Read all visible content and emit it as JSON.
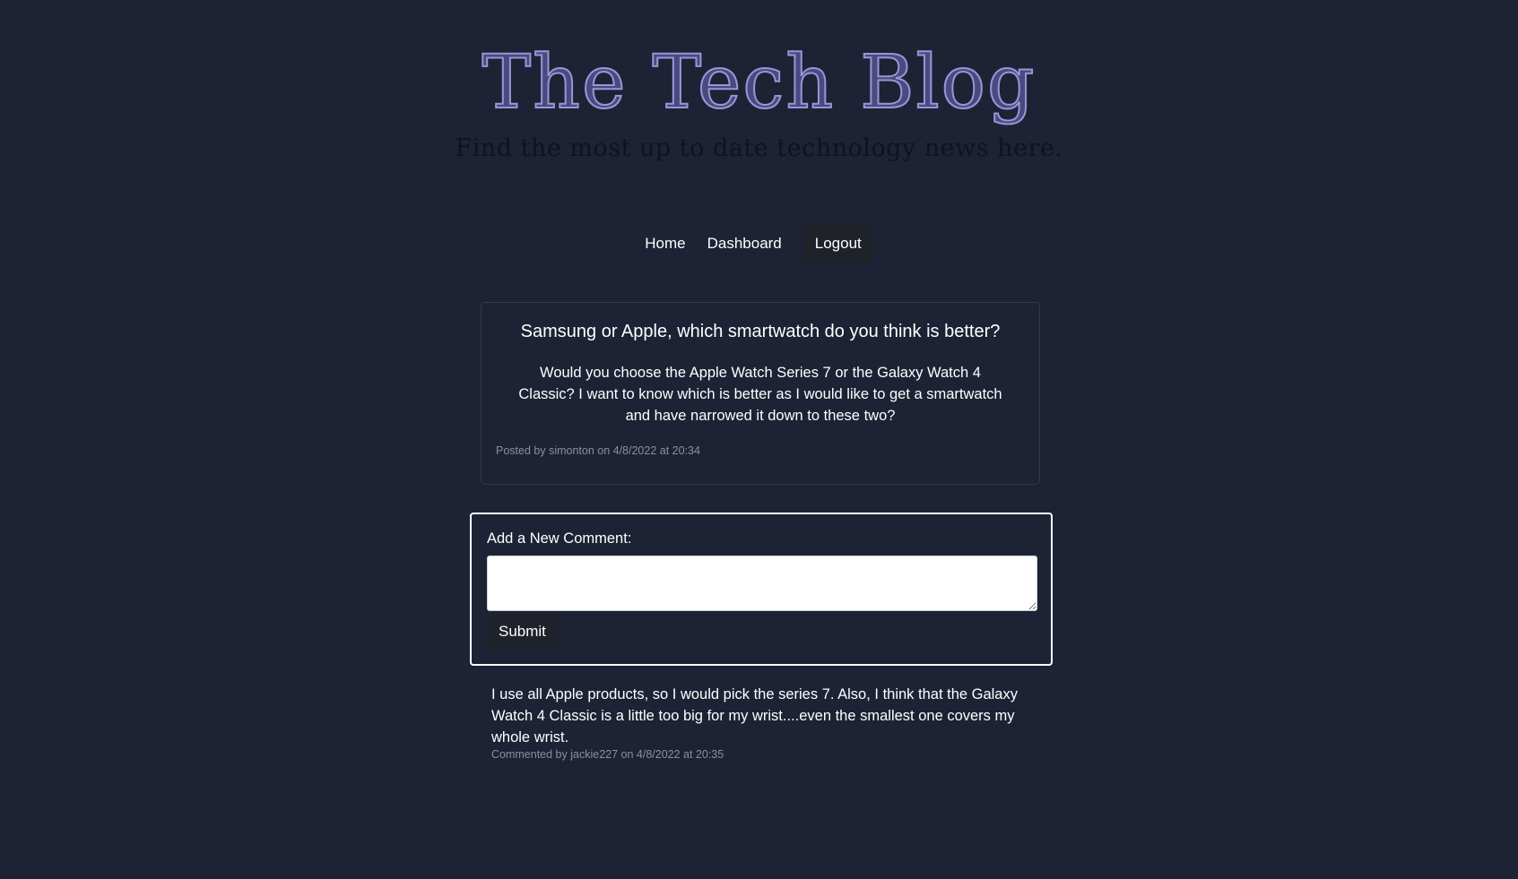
{
  "header": {
    "title": "The Tech Blog",
    "subtitle": "Find the most up to date technology news here."
  },
  "nav": {
    "home_label": "Home",
    "dashboard_label": "Dashboard",
    "logout_label": "Logout"
  },
  "post": {
    "title": "Samsung or Apple, which smartwatch do you think is better?",
    "body": "Would you choose the Apple Watch Series 7 or the Galaxy Watch 4 Classic? I want to know which is better as I would like to get a smartwatch and have narrowed it down to these two?",
    "meta": "Posted by simonton on 4/8/2022 at 20:34"
  },
  "comment_form": {
    "label": "Add a New Comment:",
    "textarea_value": "",
    "submit_label": "Submit"
  },
  "comments": [
    {
      "text": "I use all Apple products, so I would pick the series 7. Also, I think that the Galaxy Watch 4 Classic is a little too big for my wrist....even the smallest one covers my whole wrist.",
      "meta": "Commented by jackie227 on 4/8/2022 at 20:35"
    }
  ],
  "colors": {
    "background": "#1d2235",
    "title_fill": "#4c4880",
    "title_outline": "#9a95d4",
    "button_bg": "#1f2228",
    "meta_text": "#8c8f9b"
  }
}
